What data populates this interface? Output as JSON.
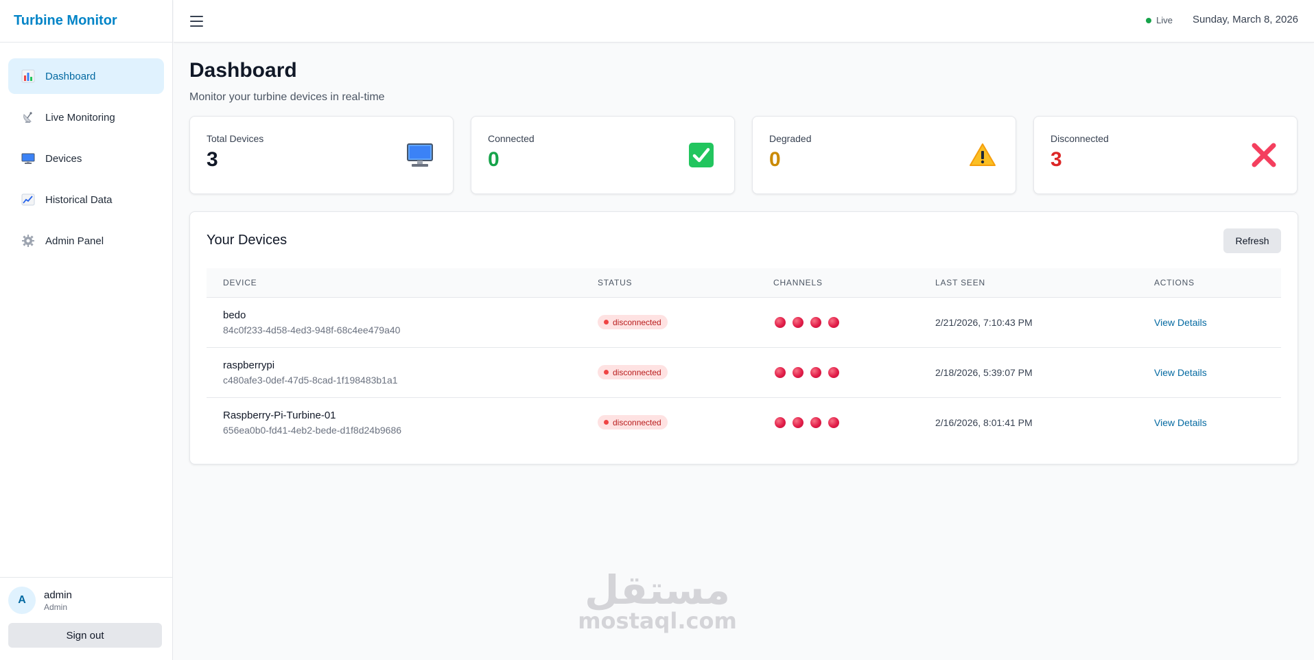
{
  "app": {
    "brand": "Turbine Monitor"
  },
  "sidebar": {
    "items": [
      {
        "label": "Dashboard",
        "icon": "bar-chart-icon",
        "active": true
      },
      {
        "label": "Live Monitoring",
        "icon": "satellite-icon"
      },
      {
        "label": "Devices",
        "icon": "monitor-icon"
      },
      {
        "label": "Historical Data",
        "icon": "line-chart-icon"
      },
      {
        "label": "Admin Panel",
        "icon": "gear-icon"
      }
    ],
    "user": {
      "avatar": "A",
      "name": "admin",
      "role": "Admin"
    },
    "signout_label": "Sign out"
  },
  "topbar": {
    "live_label": "Live",
    "date": "Sunday, March 8, 2026"
  },
  "page": {
    "title": "Dashboard",
    "subtitle": "Monitor your turbine devices in real-time"
  },
  "stats": [
    {
      "label": "Total Devices",
      "value": "3",
      "color": "#111827",
      "icon": "computer-icon"
    },
    {
      "label": "Connected",
      "value": "0",
      "color": "#16a34a",
      "icon": "check-icon"
    },
    {
      "label": "Degraded",
      "value": "0",
      "color": "#ca8a04",
      "icon": "warning-icon"
    },
    {
      "label": "Disconnected",
      "value": "3",
      "color": "#dc2626",
      "icon": "x-icon"
    }
  ],
  "devices": {
    "title": "Your Devices",
    "refresh_label": "Refresh",
    "columns": [
      "DEVICE",
      "STATUS",
      "CHANNELS",
      "LAST SEEN",
      "ACTIONS"
    ],
    "rows": [
      {
        "name": "bedo",
        "id": "84c0f233-4d58-4ed3-948f-68c4ee479a40",
        "status": "disconnected",
        "last_seen": "2/21/2026, 7:10:43 PM",
        "action": "View Details"
      },
      {
        "name": "raspberrypi",
        "id": "c480afe3-0def-47d5-8cad-1f198483b1a1",
        "status": "disconnected",
        "last_seen": "2/18/2026, 5:39:07 PM",
        "action": "View Details"
      },
      {
        "name": "Raspberry-Pi-Turbine-01",
        "id": "656ea0b0-fd41-4eb2-bede-d1f8d24b9686",
        "status": "disconnected",
        "last_seen": "2/16/2026, 8:01:41 PM",
        "action": "View Details"
      }
    ]
  },
  "watermark": {
    "arabic": "مستقل",
    "latin": "mostaql.com"
  }
}
